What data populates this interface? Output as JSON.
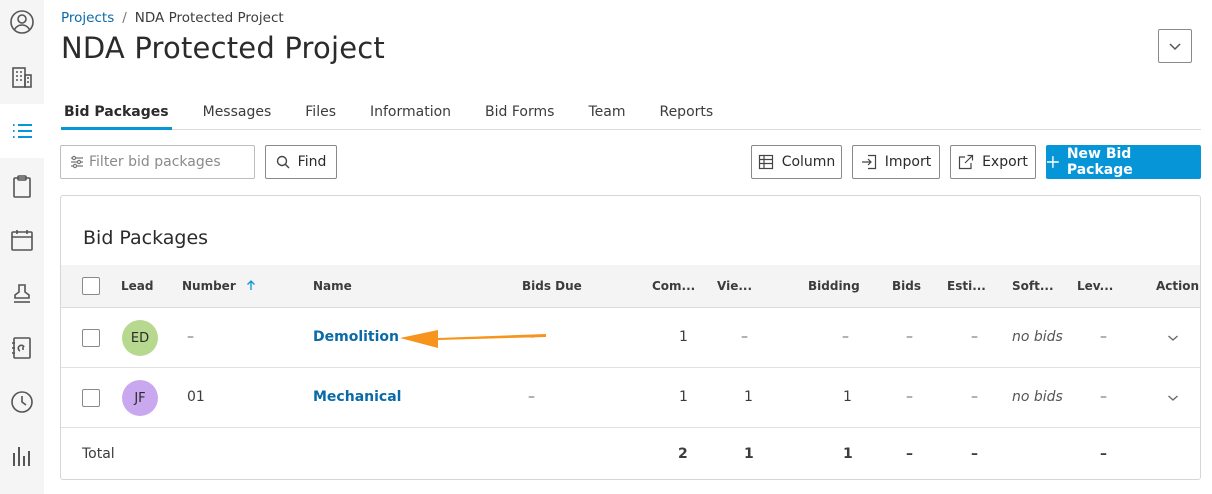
{
  "rail": {
    "items": [
      {
        "icon": "user-circle-icon"
      },
      {
        "icon": "building-icon"
      },
      {
        "icon": "list-icon",
        "active": true
      },
      {
        "icon": "clipboard-icon"
      },
      {
        "icon": "calendar-icon"
      },
      {
        "icon": "stamp-icon"
      },
      {
        "icon": "contacts-book-icon"
      },
      {
        "icon": "clock-icon"
      },
      {
        "icon": "bar-chart-icon"
      }
    ]
  },
  "breadcrumb": {
    "root": "Projects",
    "separator": "/",
    "current": "NDA Protected Project"
  },
  "page_title": "NDA Protected Project",
  "tabs": [
    {
      "label": "Bid Packages",
      "active": true
    },
    {
      "label": "Messages"
    },
    {
      "label": "Files"
    },
    {
      "label": "Information"
    },
    {
      "label": "Bid Forms"
    },
    {
      "label": "Team"
    },
    {
      "label": "Reports"
    }
  ],
  "toolbar": {
    "filter_placeholder": "Filter bid packages",
    "find_label": "Find",
    "column_label": "Column",
    "import_label": "Import",
    "export_label": "Export",
    "new_label": "New Bid Package"
  },
  "card": {
    "title": "Bid Packages",
    "columns": {
      "lead": "Lead",
      "number": "Number",
      "name": "Name",
      "bids_due": "Bids Due",
      "committed": "Com...",
      "viewed": "Vie...",
      "bidding": "Bidding",
      "bids": "Bids",
      "estimate": "Esti...",
      "software": "Soft...",
      "leveling": "Lev...",
      "action": "Action"
    },
    "rows": [
      {
        "initials": "ED",
        "avatar_color": "#b7d88f",
        "number": "–",
        "name": "Demolition",
        "bids_due": "–",
        "committed": "1",
        "viewed": "–",
        "bidding": "–",
        "bids": "–",
        "estimate": "–",
        "software": "no bids",
        "leveling": "–"
      },
      {
        "initials": "JF",
        "avatar_color": "#c9a8f0",
        "number": "01",
        "name": "Mechanical",
        "bids_due": "–",
        "committed": "1",
        "viewed": "1",
        "bidding": "1",
        "bids": "–",
        "estimate": "–",
        "software": "no bids",
        "leveling": "–"
      }
    ],
    "total": {
      "label": "Total",
      "committed": "2",
      "viewed": "1",
      "bidding": "1",
      "bids": "–",
      "estimate": "–",
      "leveling": "–"
    }
  },
  "colors": {
    "accent": "#0696d7",
    "link": "#0a6aa8",
    "annotation_arrow": "#f7941d"
  }
}
